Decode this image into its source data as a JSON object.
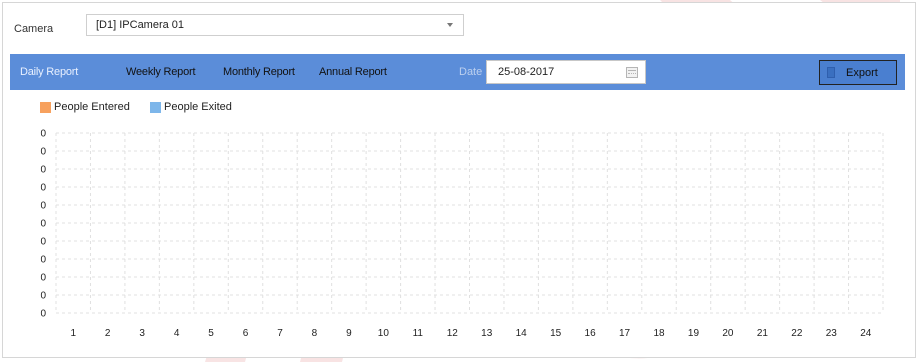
{
  "camera": {
    "label": "Camera",
    "selected": "[D1] IPCamera 01"
  },
  "tabs": [
    {
      "label": "Daily Report",
      "active": true
    },
    {
      "label": "Weekly Report",
      "active": false
    },
    {
      "label": "Monthly Report",
      "active": false
    },
    {
      "label": "Annual Report",
      "active": false
    }
  ],
  "date": {
    "label": "Date",
    "value": "25-08-2017"
  },
  "export": {
    "label": "Export"
  },
  "colors": {
    "toolbar": "#5b8dd9",
    "entered": "#f7a15e",
    "exited": "#7db6ea"
  },
  "chart_data": {
    "type": "bar",
    "categories": [
      "1",
      "2",
      "3",
      "4",
      "5",
      "6",
      "7",
      "8",
      "9",
      "10",
      "11",
      "12",
      "13",
      "14",
      "15",
      "16",
      "17",
      "18",
      "19",
      "20",
      "21",
      "22",
      "23",
      "24"
    ],
    "series": [
      {
        "name": "People Entered",
        "values": [
          0,
          0,
          0,
          0,
          0,
          0,
          0,
          0,
          0,
          0,
          0,
          0,
          0,
          0,
          0,
          0,
          0,
          0,
          0,
          0,
          0,
          0,
          0,
          0
        ]
      },
      {
        "name": "People Exited",
        "values": [
          0,
          0,
          0,
          0,
          0,
          0,
          0,
          0,
          0,
          0,
          0,
          0,
          0,
          0,
          0,
          0,
          0,
          0,
          0,
          0,
          0,
          0,
          0,
          0
        ]
      }
    ],
    "y_ticks": [
      "0",
      "0",
      "0",
      "0",
      "0",
      "0",
      "0",
      "0",
      "0",
      "0",
      "0"
    ],
    "grid": true,
    "legend": "top-left"
  }
}
